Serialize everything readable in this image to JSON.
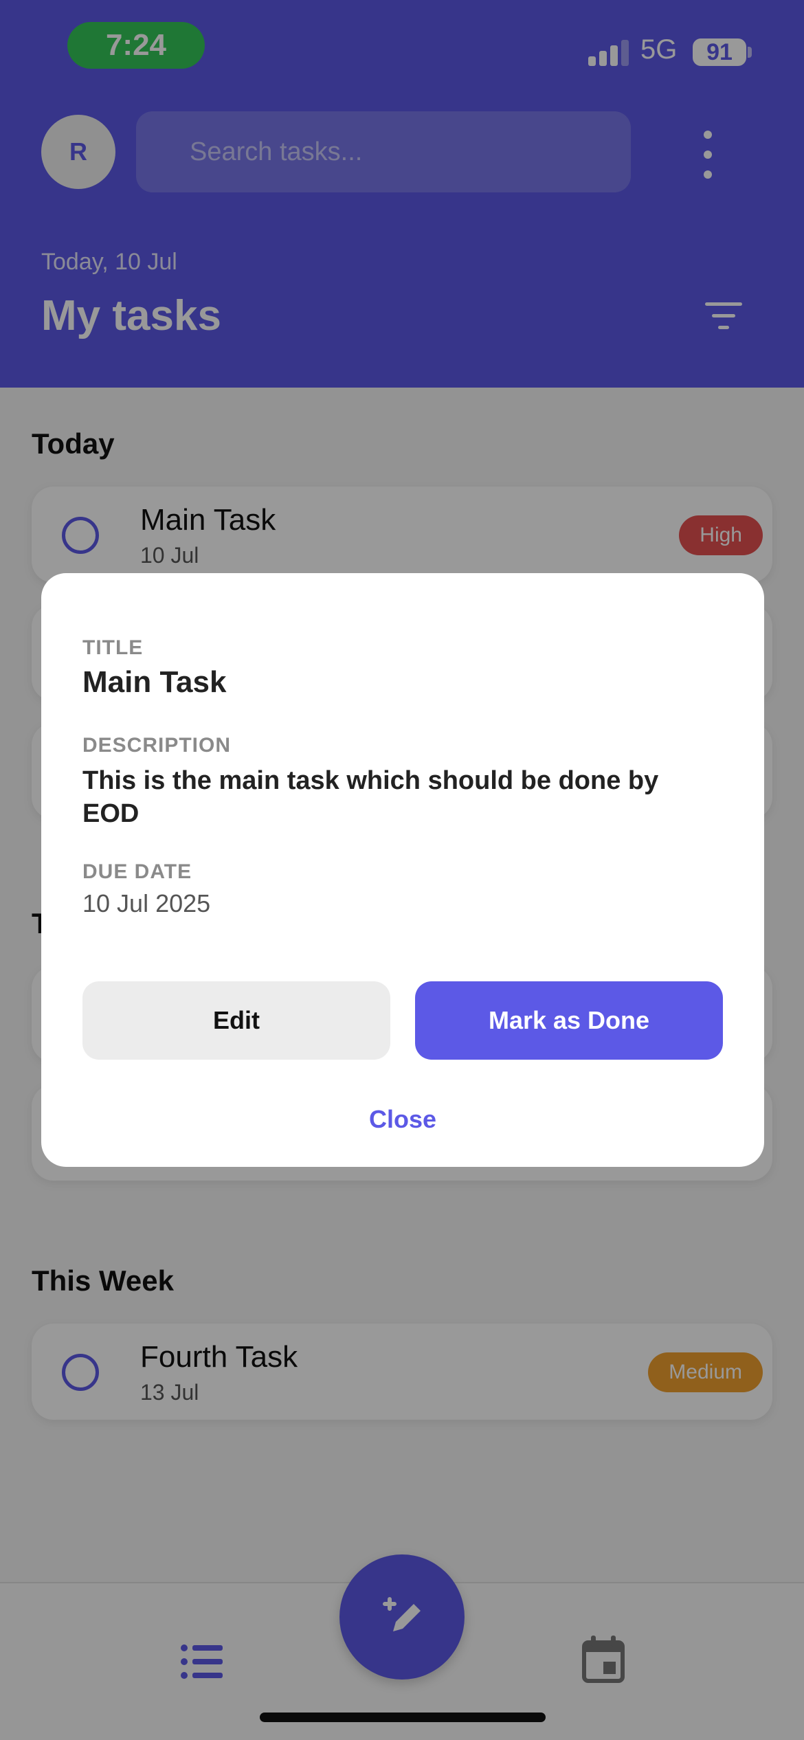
{
  "status_bar": {
    "time": "7:24",
    "network": "5G",
    "battery": "91"
  },
  "header": {
    "avatar_initial": "R",
    "search_placeholder": "Search tasks...",
    "date_label": "Today, 10 Jul",
    "title": "My tasks"
  },
  "sections": [
    {
      "title": "Today"
    },
    {
      "title": "T"
    },
    {
      "title": "This Week"
    }
  ],
  "tasks": {
    "today_first": {
      "title": "Main Task",
      "due": "10 Jul",
      "priority": "High",
      "priority_color": "#e45050"
    },
    "week_first": {
      "title": "Fourth Task",
      "due": "13 Jul",
      "priority": "Medium",
      "priority_color": "#f0a030"
    }
  },
  "modal": {
    "title_label": "TITLE",
    "title_value": "Main Task",
    "description_label": "DESCRIPTION",
    "description_value": "This is the main task which should be done by EOD",
    "due_label": "DUE DATE",
    "due_value": "10 Jul 2025",
    "edit_label": "Edit",
    "done_label": "Mark as Done",
    "close_label": "Close"
  },
  "bottom_nav": {
    "left_icon": "list-icon",
    "center_icon": "edit-pencil-icon",
    "right_icon": "calendar-icon"
  },
  "colors": {
    "primary": "#5c59e6",
    "status_time": "#34c759"
  }
}
